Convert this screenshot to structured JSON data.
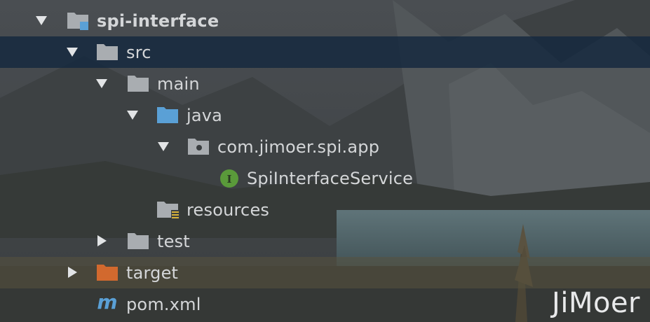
{
  "tree": {
    "items": [
      {
        "label": "spi-interface",
        "icon": "module-folder-icon",
        "expanded": true
      },
      {
        "label": "src",
        "icon": "folder-icon",
        "expanded": true,
        "selected": true
      },
      {
        "label": "main",
        "icon": "folder-icon",
        "expanded": true
      },
      {
        "label": "java",
        "icon": "source-folder-icon",
        "expanded": true
      },
      {
        "label": "com.jimoer.spi.app",
        "icon": "package-icon",
        "expanded": true
      },
      {
        "label": "SpiInterfaceService",
        "icon": "interface-icon",
        "badge": "I"
      },
      {
        "label": "resources",
        "icon": "resources-folder-icon"
      },
      {
        "label": "test",
        "icon": "folder-icon",
        "expanded": false
      },
      {
        "label": "target",
        "icon": "excluded-folder-icon",
        "expanded": false
      },
      {
        "label": "pom.xml",
        "icon": "maven-icon",
        "badge": "m"
      }
    ]
  },
  "colors": {
    "selection": "#14283e",
    "folder": "#a9adb1",
    "source_folder": "#5aa0d6",
    "excluded_folder": "#d2692e",
    "interface_badge": "#5a9a3a",
    "maven": "#5aa0d6"
  },
  "watermark": "JiMoer"
}
